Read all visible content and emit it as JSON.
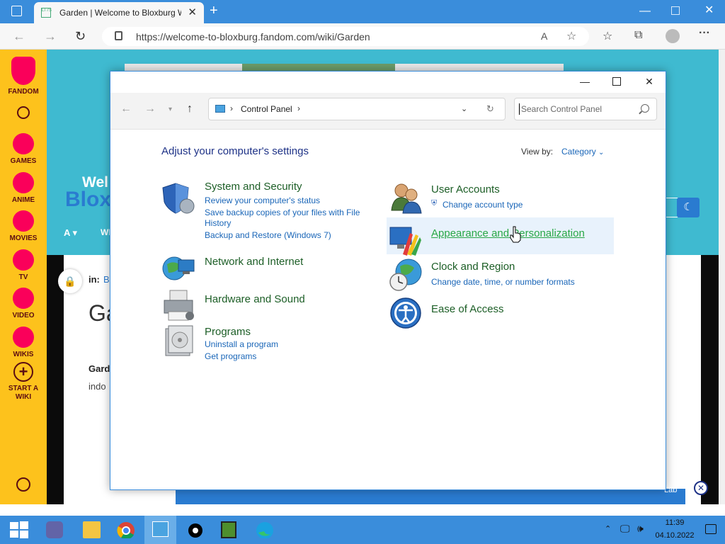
{
  "browser": {
    "tab_title": "Garden | Welcome to Bloxburg W",
    "url": "https://welcome-to-bloxburg.fandom.com/wiki/Garden",
    "favicon_text": "LT7S"
  },
  "fandom_rail": {
    "logo_label": "FANDOM",
    "items": [
      {
        "label": "GAMES"
      },
      {
        "label": "ANIME"
      },
      {
        "label": "MOVIES"
      },
      {
        "label": "TV"
      },
      {
        "label": "VIDEO"
      },
      {
        "label": "WIKIS"
      },
      {
        "label": "START A WIKI"
      }
    ]
  },
  "wiki_page": {
    "banner_text_1": "Wel",
    "banner_text_2": "Blox",
    "nav_partial": "WI",
    "in_label": "in:",
    "in_value": "B",
    "title_partial": "Ga",
    "para_bold": "Gard",
    "para_text": "indo",
    "ad_label": "Lab"
  },
  "control_panel": {
    "breadcrumb": "Control Panel",
    "search_placeholder": "Search Control Panel",
    "heading": "Adjust your computer's settings",
    "view_by_label": "View by:",
    "view_by_value": "Category",
    "left_categories": [
      {
        "title": "System and Security",
        "links": [
          "Review your computer's status",
          "Save backup copies of your files with File",
          "History",
          "Backup and Restore (Windows 7)"
        ]
      },
      {
        "title": "Network and Internet",
        "links": []
      },
      {
        "title": "Hardware and Sound",
        "links": []
      },
      {
        "title": "Programs",
        "links": [
          "Uninstall a program",
          "Get programs"
        ]
      }
    ],
    "right_categories": [
      {
        "title": "User Accounts",
        "links": [
          "Change account type"
        ]
      },
      {
        "title": "Appearance and Personalization",
        "links": []
      },
      {
        "title": "Clock and Region",
        "links": [
          "Change date, time, or number formats"
        ]
      },
      {
        "title": "Ease of Access",
        "links": []
      }
    ]
  },
  "taskbar": {
    "time": "11:39",
    "date": "04.10.2022"
  }
}
